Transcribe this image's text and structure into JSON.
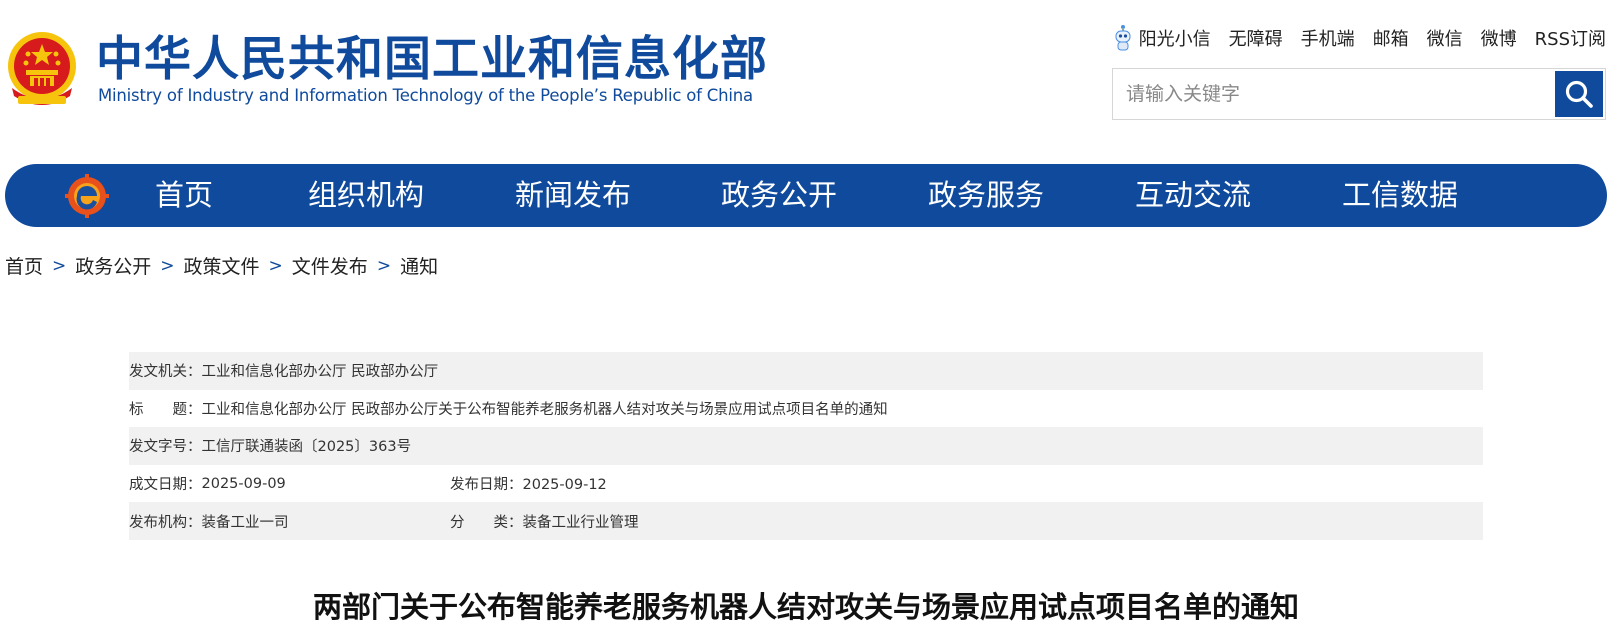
{
  "header": {
    "title": "中华人民共和国工业和信息化部",
    "subtitle": "Ministry of Industry and Information Technology of the People’s Republic of China",
    "top_links": [
      "阳光小信",
      "无障碍",
      "手机端",
      "邮箱",
      "微信",
      "微博",
      "RSS订阅"
    ],
    "search_placeholder": "请输入关键字"
  },
  "nav": {
    "items": [
      "首页",
      "组织机构",
      "新闻发布",
      "政务公开",
      "政务服务",
      "互动交流",
      "工信数据"
    ]
  },
  "breadcrumb": {
    "items": [
      "首页",
      "政务公开",
      "政策文件",
      "文件发布",
      "通知"
    ],
    "separator": ">"
  },
  "info": {
    "issuer_label": "发文机关：",
    "issuer_value": "工业和信息化部办公厅 民政部办公厅",
    "title_label": "标　　题：",
    "title_value": "工业和信息化部办公厅 民政部办公厅关于公布智能养老服务机器人结对攻关与场景应用试点项目名单的通知",
    "doc_no_label": "发文字号：",
    "doc_no_value": "工信厅联通装函〔2025〕363号",
    "written_date_label": "成文日期：",
    "written_date_value": "2025-09-09",
    "publish_date_label": "发布日期：",
    "publish_date_value": "2025-09-12",
    "publisher_label": "发布机构：",
    "publisher_value": "装备工业一司",
    "category_label": "分　　类：",
    "category_value": "装备工业行业管理"
  },
  "article": {
    "title": "两部门关于公布智能养老服务机器人结对攻关与场景应用试点项目名单的通知"
  },
  "colors": {
    "brand_blue": "#0f4a9c",
    "shade_gray": "#f1f1f1",
    "emblem_red": "#d71a1b",
    "emblem_gold": "#f6c40d"
  }
}
